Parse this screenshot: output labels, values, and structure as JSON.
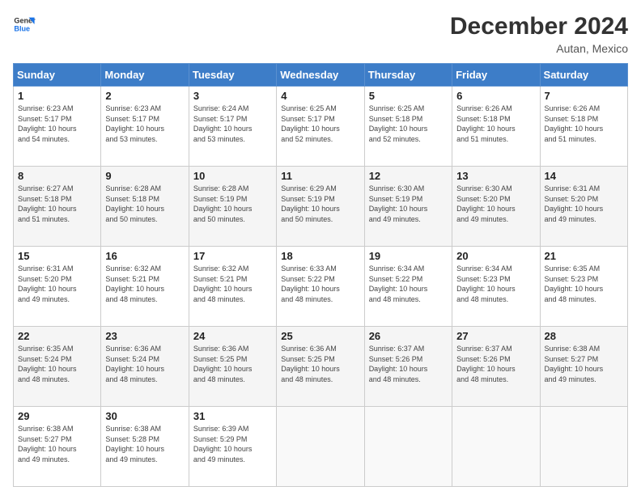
{
  "logo": {
    "line1": "General",
    "line2": "Blue"
  },
  "title": "December 2024",
  "subtitle": "Autan, Mexico",
  "header_days": [
    "Sunday",
    "Monday",
    "Tuesday",
    "Wednesday",
    "Thursday",
    "Friday",
    "Saturday"
  ],
  "weeks": [
    [
      {
        "day": "1",
        "info": "Sunrise: 6:23 AM\nSunset: 5:17 PM\nDaylight: 10 hours\nand 54 minutes."
      },
      {
        "day": "2",
        "info": "Sunrise: 6:23 AM\nSunset: 5:17 PM\nDaylight: 10 hours\nand 53 minutes."
      },
      {
        "day": "3",
        "info": "Sunrise: 6:24 AM\nSunset: 5:17 PM\nDaylight: 10 hours\nand 53 minutes."
      },
      {
        "day": "4",
        "info": "Sunrise: 6:25 AM\nSunset: 5:17 PM\nDaylight: 10 hours\nand 52 minutes."
      },
      {
        "day": "5",
        "info": "Sunrise: 6:25 AM\nSunset: 5:18 PM\nDaylight: 10 hours\nand 52 minutes."
      },
      {
        "day": "6",
        "info": "Sunrise: 6:26 AM\nSunset: 5:18 PM\nDaylight: 10 hours\nand 51 minutes."
      },
      {
        "day": "7",
        "info": "Sunrise: 6:26 AM\nSunset: 5:18 PM\nDaylight: 10 hours\nand 51 minutes."
      }
    ],
    [
      {
        "day": "8",
        "info": "Sunrise: 6:27 AM\nSunset: 5:18 PM\nDaylight: 10 hours\nand 51 minutes."
      },
      {
        "day": "9",
        "info": "Sunrise: 6:28 AM\nSunset: 5:18 PM\nDaylight: 10 hours\nand 50 minutes."
      },
      {
        "day": "10",
        "info": "Sunrise: 6:28 AM\nSunset: 5:19 PM\nDaylight: 10 hours\nand 50 minutes."
      },
      {
        "day": "11",
        "info": "Sunrise: 6:29 AM\nSunset: 5:19 PM\nDaylight: 10 hours\nand 50 minutes."
      },
      {
        "day": "12",
        "info": "Sunrise: 6:30 AM\nSunset: 5:19 PM\nDaylight: 10 hours\nand 49 minutes."
      },
      {
        "day": "13",
        "info": "Sunrise: 6:30 AM\nSunset: 5:20 PM\nDaylight: 10 hours\nand 49 minutes."
      },
      {
        "day": "14",
        "info": "Sunrise: 6:31 AM\nSunset: 5:20 PM\nDaylight: 10 hours\nand 49 minutes."
      }
    ],
    [
      {
        "day": "15",
        "info": "Sunrise: 6:31 AM\nSunset: 5:20 PM\nDaylight: 10 hours\nand 49 minutes."
      },
      {
        "day": "16",
        "info": "Sunrise: 6:32 AM\nSunset: 5:21 PM\nDaylight: 10 hours\nand 48 minutes."
      },
      {
        "day": "17",
        "info": "Sunrise: 6:32 AM\nSunset: 5:21 PM\nDaylight: 10 hours\nand 48 minutes."
      },
      {
        "day": "18",
        "info": "Sunrise: 6:33 AM\nSunset: 5:22 PM\nDaylight: 10 hours\nand 48 minutes."
      },
      {
        "day": "19",
        "info": "Sunrise: 6:34 AM\nSunset: 5:22 PM\nDaylight: 10 hours\nand 48 minutes."
      },
      {
        "day": "20",
        "info": "Sunrise: 6:34 AM\nSunset: 5:23 PM\nDaylight: 10 hours\nand 48 minutes."
      },
      {
        "day": "21",
        "info": "Sunrise: 6:35 AM\nSunset: 5:23 PM\nDaylight: 10 hours\nand 48 minutes."
      }
    ],
    [
      {
        "day": "22",
        "info": "Sunrise: 6:35 AM\nSunset: 5:24 PM\nDaylight: 10 hours\nand 48 minutes."
      },
      {
        "day": "23",
        "info": "Sunrise: 6:36 AM\nSunset: 5:24 PM\nDaylight: 10 hours\nand 48 minutes."
      },
      {
        "day": "24",
        "info": "Sunrise: 6:36 AM\nSunset: 5:25 PM\nDaylight: 10 hours\nand 48 minutes."
      },
      {
        "day": "25",
        "info": "Sunrise: 6:36 AM\nSunset: 5:25 PM\nDaylight: 10 hours\nand 48 minutes."
      },
      {
        "day": "26",
        "info": "Sunrise: 6:37 AM\nSunset: 5:26 PM\nDaylight: 10 hours\nand 48 minutes."
      },
      {
        "day": "27",
        "info": "Sunrise: 6:37 AM\nSunset: 5:26 PM\nDaylight: 10 hours\nand 48 minutes."
      },
      {
        "day": "28",
        "info": "Sunrise: 6:38 AM\nSunset: 5:27 PM\nDaylight: 10 hours\nand 49 minutes."
      }
    ],
    [
      {
        "day": "29",
        "info": "Sunrise: 6:38 AM\nSunset: 5:27 PM\nDaylight: 10 hours\nand 49 minutes."
      },
      {
        "day": "30",
        "info": "Sunrise: 6:38 AM\nSunset: 5:28 PM\nDaylight: 10 hours\nand 49 minutes."
      },
      {
        "day": "31",
        "info": "Sunrise: 6:39 AM\nSunset: 5:29 PM\nDaylight: 10 hours\nand 49 minutes."
      },
      {
        "day": "",
        "info": ""
      },
      {
        "day": "",
        "info": ""
      },
      {
        "day": "",
        "info": ""
      },
      {
        "day": "",
        "info": ""
      }
    ]
  ]
}
